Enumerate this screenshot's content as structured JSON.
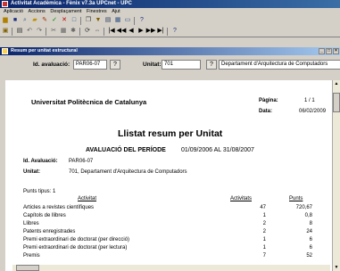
{
  "app": {
    "title": "Activitat Acadèmica - Fènix v7.3a UPCnet - UPC"
  },
  "menu": [
    "Aplicació",
    "Accions",
    "Desplaçament",
    "Finestres",
    "Ajut"
  ],
  "toolbar1": {
    "icons": [
      "open-icon",
      "save-icon",
      "find-icon",
      "folder-icon",
      "edit-icon",
      "check-icon",
      "delete-icon",
      "new-icon",
      "copy-icon",
      "filter-icon",
      "print-icon",
      "grid-icon",
      "window-icon",
      "help-icon"
    ]
  },
  "toolbar2": {
    "icons": [
      "save-icon",
      "print-icon",
      "undo-icon",
      "redo-icon",
      "cut-icon",
      "paste-icon",
      "query-icon",
      "refresh-icon",
      "zoom-icon",
      "first-icon",
      "prev-page-icon",
      "prev-icon",
      "next-icon",
      "next-page-icon",
      "last-icon",
      "help-icon"
    ]
  },
  "inner_window": {
    "title": "Resum per unitat estructural"
  },
  "filter": {
    "id_label": "Id. avaluació:",
    "id_value": "PAR06-07",
    "unit_label": "Unitat:",
    "unit_code": "701",
    "unit_name": "Departament d'Arquitectura de Computadors"
  },
  "report": {
    "university": "Universitat Politècnica de Catalunya",
    "page_label": "Pàgina:",
    "page_value": "1 / 1",
    "date_label": "Data:",
    "date_value": "06/02/2009",
    "title": "Llistat resum per Unitat",
    "period_label": "AVALUACIÓ DEL PERÍODE",
    "period_value": "01/09/2006 AL 31/08/2007",
    "id_label": "Id. Avaluació:",
    "id_value": "PAR06-07",
    "unit_label": "Unitat:",
    "unit_value": "701, Departament d'Arquitectura de Computadors",
    "type_label": "Punts tipus: 1",
    "columns": [
      "Activitat",
      "Activitats",
      "Punts"
    ],
    "rows": [
      {
        "activity": "Articles a revistes científiques",
        "count": "47",
        "points": "720,67"
      },
      {
        "activity": "Capítols de llibres",
        "count": "1",
        "points": "0,8"
      },
      {
        "activity": "Llibres",
        "count": "2",
        "points": "8"
      },
      {
        "activity": "Patents enregistrades",
        "count": "2",
        "points": "24"
      },
      {
        "activity": "Premi extraordinari de doctorat (per direcció)",
        "count": "1",
        "points": "6"
      },
      {
        "activity": "Premi extraordinari de doctorat (per lectura)",
        "count": "1",
        "points": "6"
      },
      {
        "activity": "Premis",
        "count": "7",
        "points": "52"
      }
    ]
  }
}
